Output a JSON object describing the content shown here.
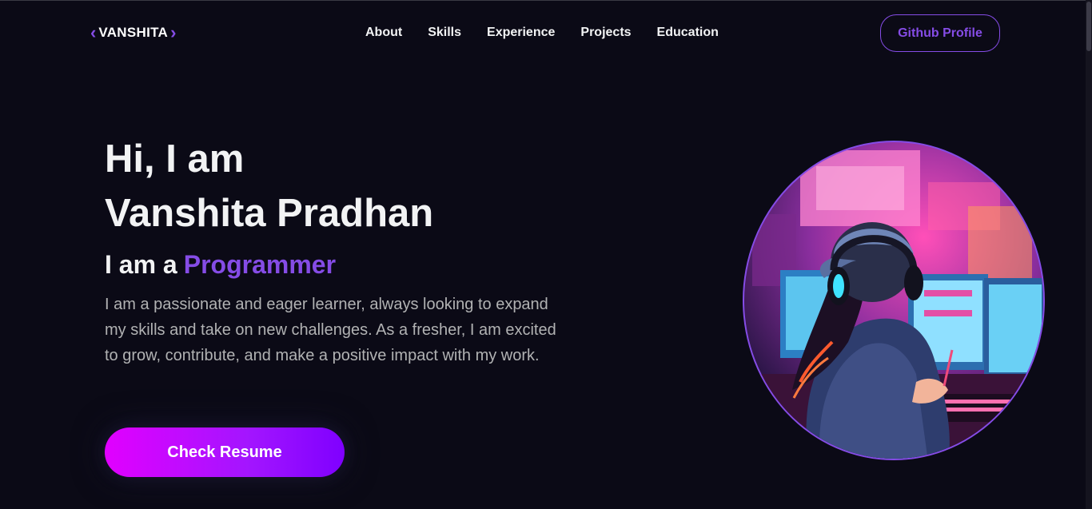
{
  "nav": {
    "logo_text": "VANSHITA",
    "links": [
      "About",
      "Skills",
      "Experience",
      "Projects",
      "Education"
    ],
    "github_label": "Github Profile"
  },
  "hero": {
    "title_line1": "Hi, I am",
    "title_line2": "Vanshita Pradhan",
    "role_prefix": "I am a",
    "role_value": "Programmer",
    "description": "I am a passionate and eager learner, always looking to expand my skills and take on new challenges. As a fresher, I am excited to grow, contribute, and make a positive impact with my work.",
    "resume_label": "Check Resume"
  },
  "colors": {
    "background": "#0b0a16",
    "primary": "#854ce6",
    "text_primary": "#f2f3f4",
    "text_secondary": "#b1b2b3",
    "button_gradient_start": "#e100ff",
    "button_gradient_end": "#7f00ff"
  },
  "icons": {
    "logo_left": "chevron-left-icon",
    "logo_right": "chevron-right-icon"
  }
}
